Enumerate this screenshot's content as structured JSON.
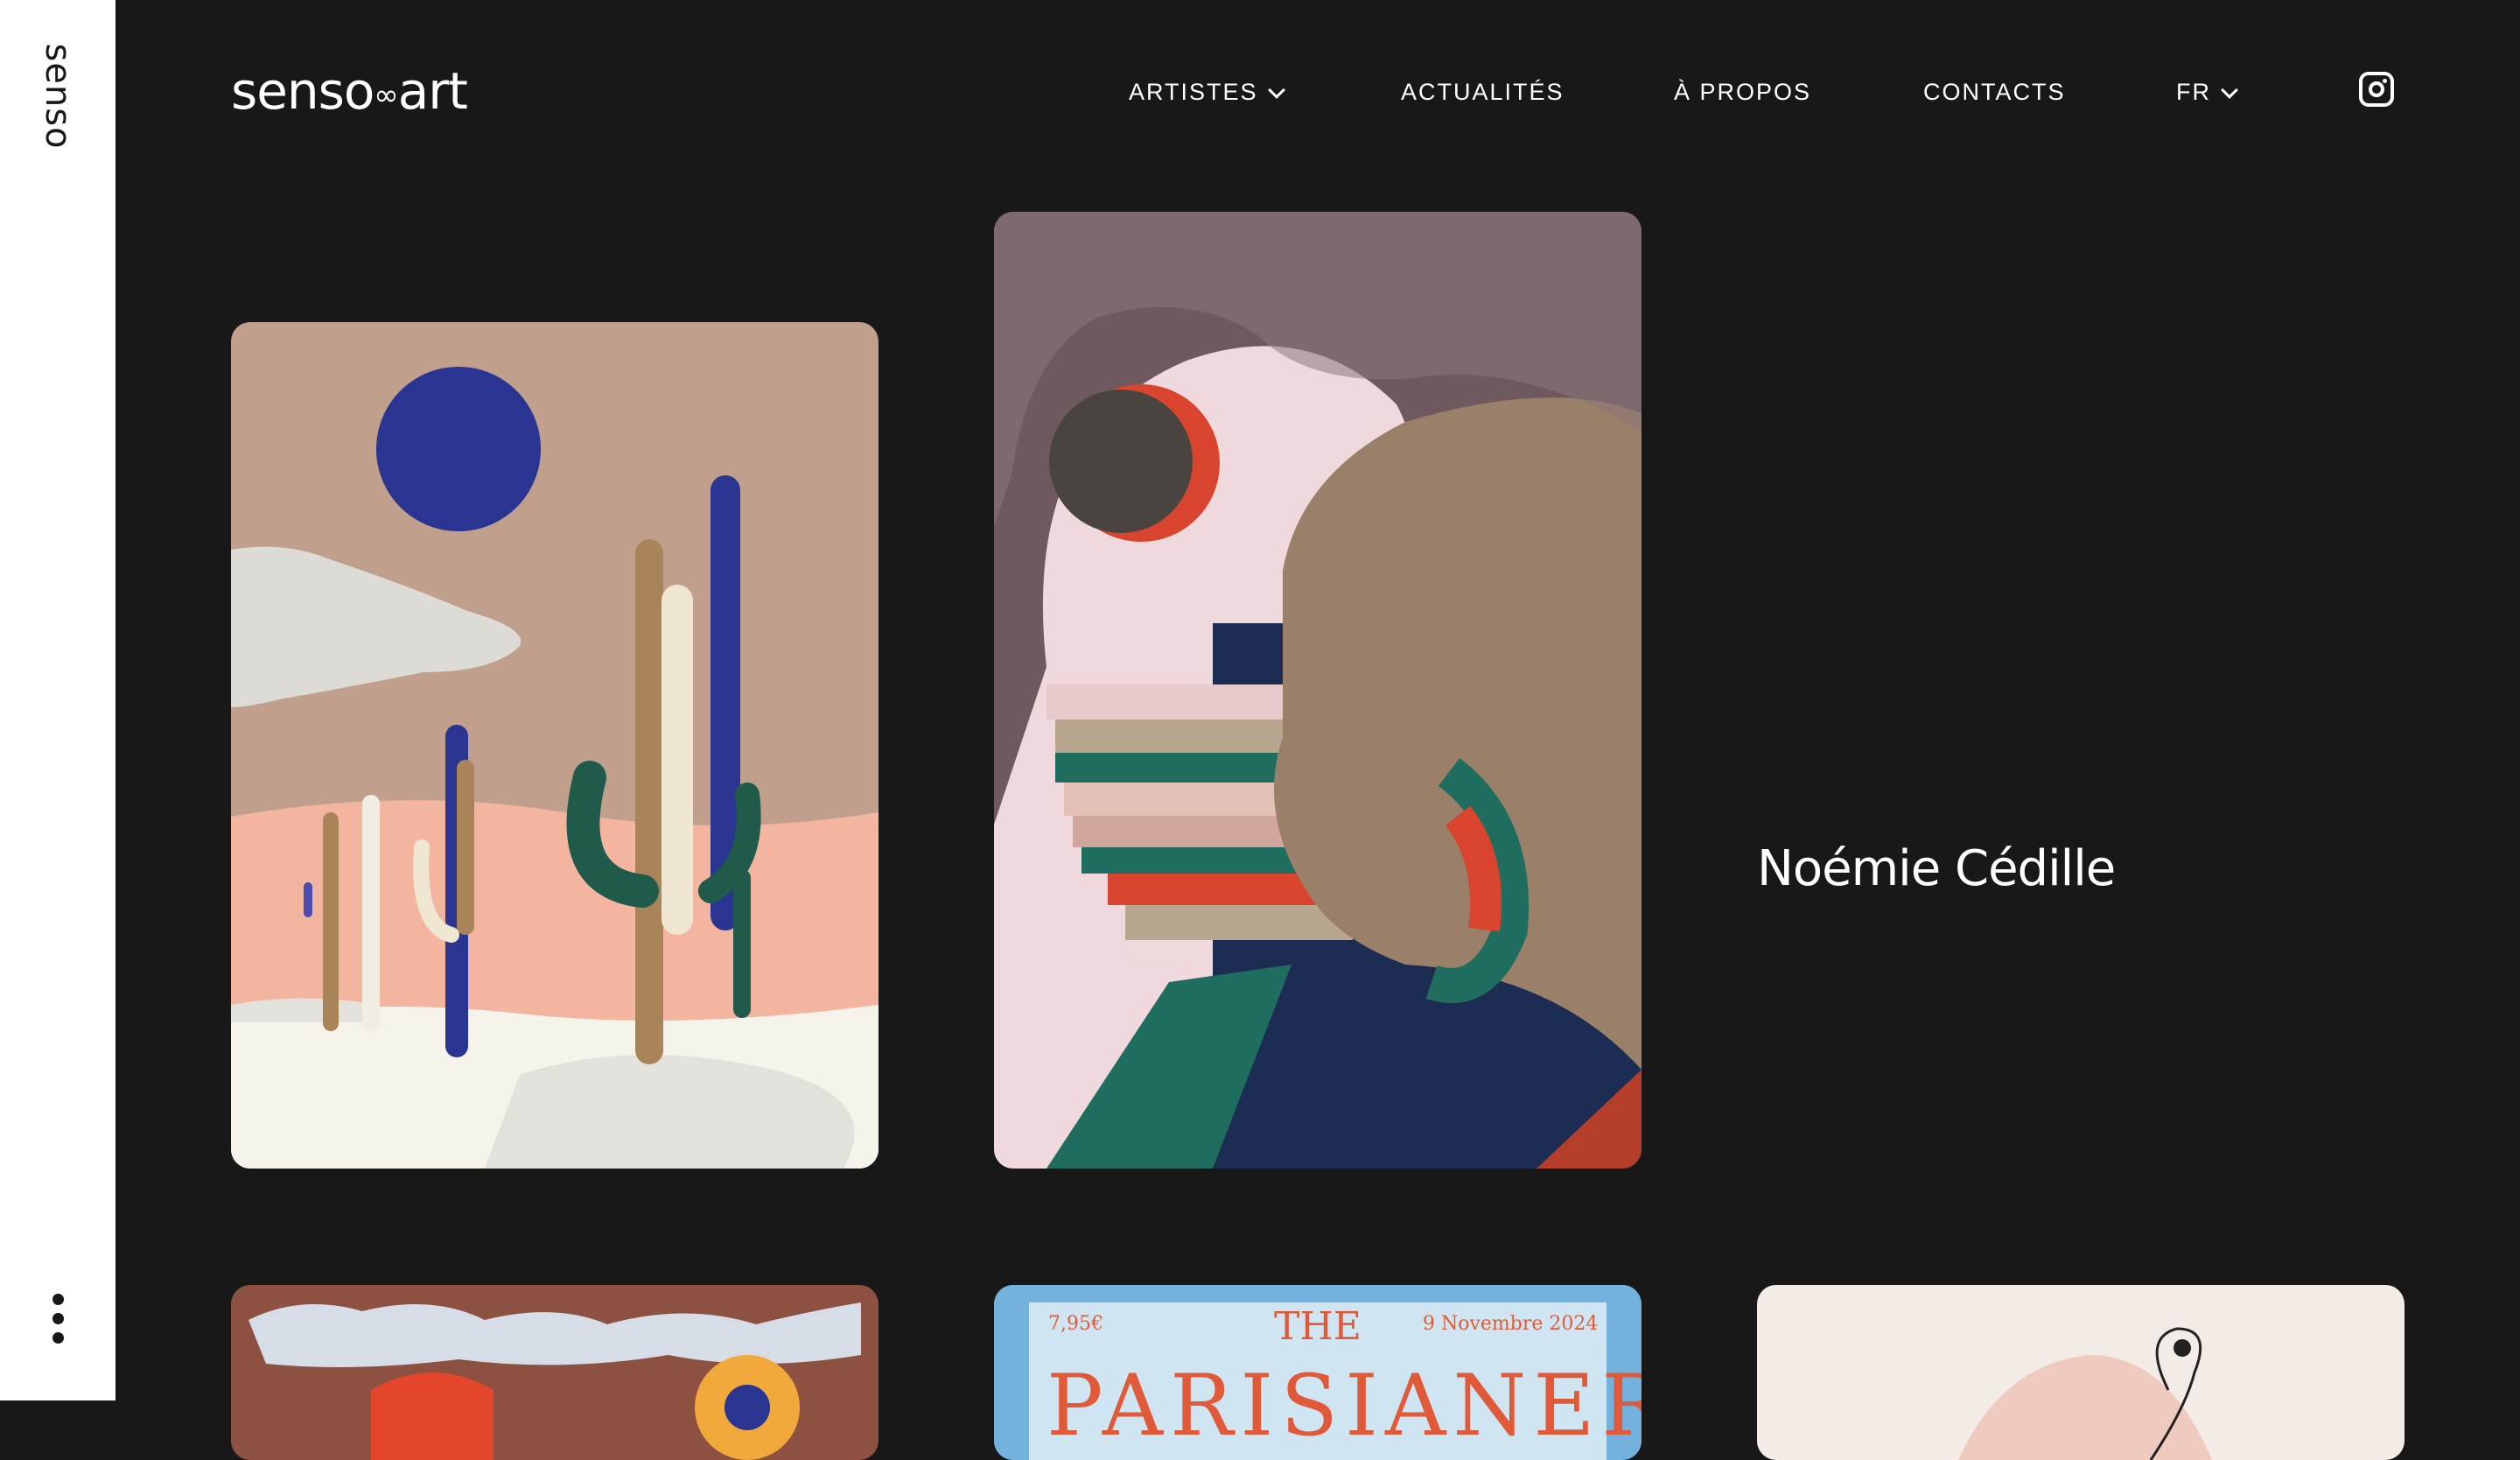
{
  "side": {
    "logo": "senso"
  },
  "header": {
    "brand": "senso",
    "brand_art": "art",
    "nav": [
      {
        "label": "ARTISTES",
        "has_dropdown": true
      },
      {
        "label": "ACTUALITÉS",
        "has_dropdown": false
      },
      {
        "label": "À PROPOS",
        "has_dropdown": false
      },
      {
        "label": "CONTACTS",
        "has_dropdown": false
      },
      {
        "label": "FR",
        "has_dropdown": true
      }
    ],
    "social_icon": "instagram-icon"
  },
  "featured": {
    "artist_name": "Noémie Cédille"
  },
  "magazine": {
    "price": "7,95€",
    "the": "THE",
    "date": "9 Novembre 2024",
    "title": "PARISIANER"
  },
  "colors": {
    "background": "#181818",
    "sidebar": "#ffffff",
    "text": "#ffffff"
  }
}
